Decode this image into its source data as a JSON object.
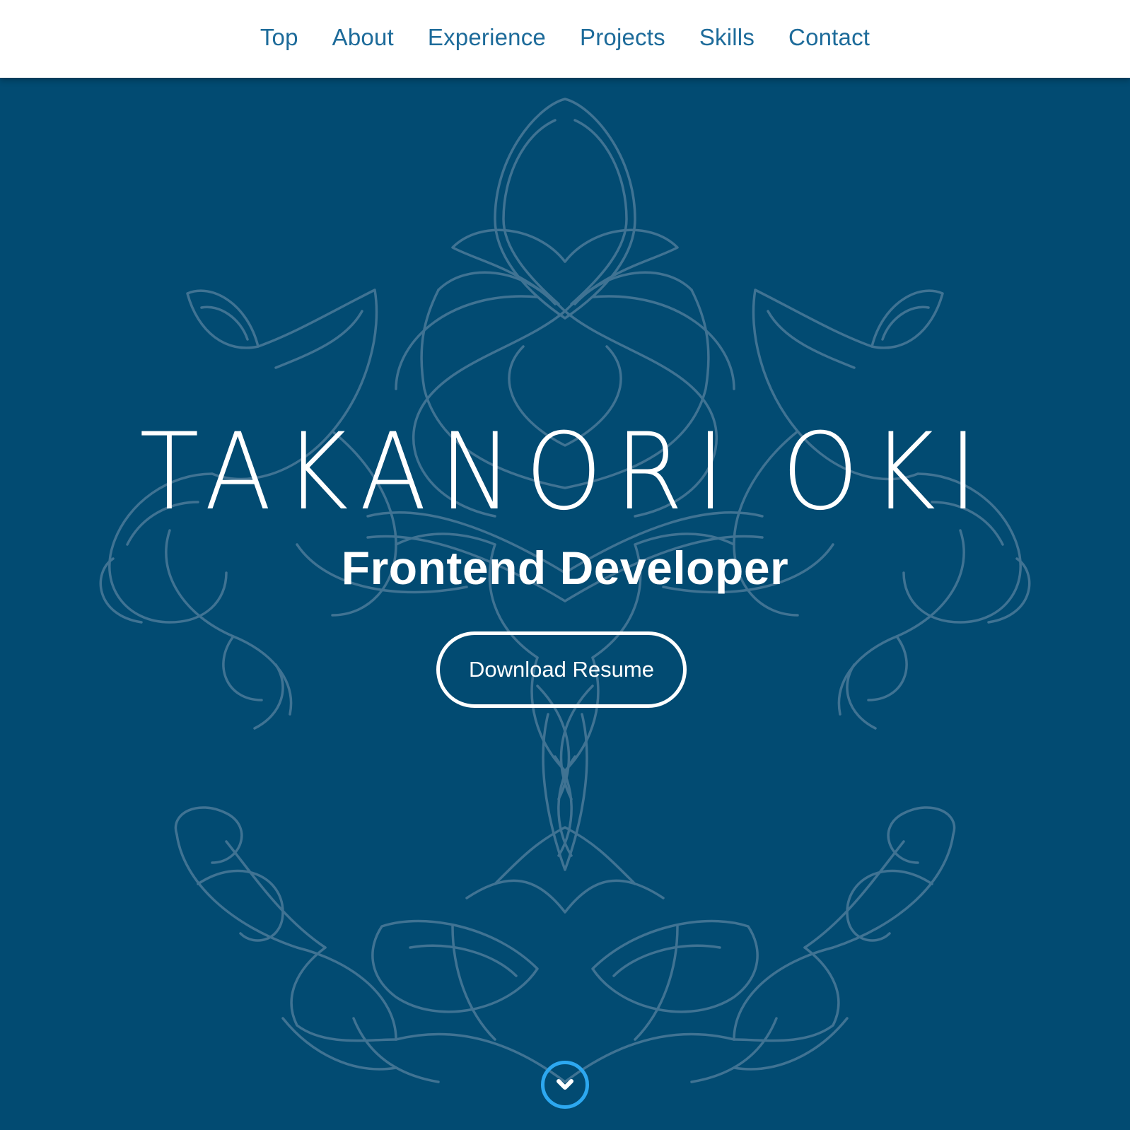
{
  "nav": {
    "items": [
      {
        "label": "Top"
      },
      {
        "label": "About"
      },
      {
        "label": "Experience"
      },
      {
        "label": "Projects"
      },
      {
        "label": "Skills"
      },
      {
        "label": "Contact"
      }
    ]
  },
  "hero": {
    "name": "TAKANORI OKI",
    "role": "Frontend Developer",
    "resume_button_label": "Download Resume",
    "scroll_icon": "chevron-down-icon"
  },
  "colors": {
    "background": "#024b72",
    "nav_background": "#ffffff",
    "nav_text": "#1d6b9a",
    "hero_text": "#ffffff",
    "scroll_accent": "#2da8f0",
    "ornament_line": "#4b7a99"
  }
}
